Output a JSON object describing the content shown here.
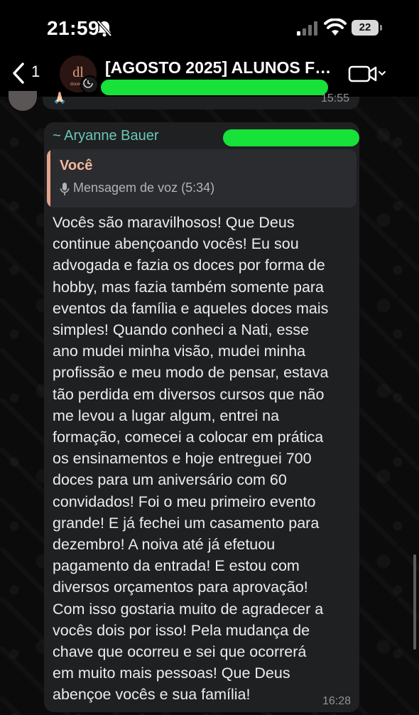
{
  "status_bar": {
    "time": "21:59",
    "battery": "22"
  },
  "header": {
    "back_count": "1",
    "title": "[AGOSTO 2025] ALUNOS FO...",
    "avatar_text": "dl",
    "avatar_subtext": "docevial"
  },
  "previous_message": {
    "emoji": "🙏🏻",
    "time": "15:55"
  },
  "message": {
    "sender": "~ Aryanne Bauer",
    "quote": {
      "author": "Você",
      "text": "Mensagem de voz (5:34)"
    },
    "text": "Vocês são maravilhosos! Que Deus\ncontinue abençoando vocês! Eu sou\nadvogada e fazia os doces por forma de\nhobby, mas fazia também somente para\neventos da família e aqueles doces mais\nsimples! Quando conheci a Nati, esse\nano mudei minha visão, mudei minha\nprofissão e meu modo de pensar, estava\ntão perdida em diversos cursos que não\nme levou a lugar algum, entrei na\nformação, comecei a colocar em prática\nos ensinamentos e hoje entreguei 700\ndoces para um aniversário com 60\nconvidados! Foi o meu primeiro evento\ngrande! E já fechei um casamento para\ndezembro! A noiva até já efetuou\npagamento da entrada! E estou com\ndiversos orçamentos para aprovação!\nCom isso gostaria muito de agradecer a\nvocês dois por isso! Pela mudança de\nchave que ocorreu e sei que ocorrerá\nem muito mais pessoas! Que Deus\nabençoe vocês e sua família!",
    "time": "16:28"
  },
  "colors": {
    "sender_name": "#6cc6b6",
    "quote_accent": "#e4a58b",
    "bubble": "#1f2022",
    "redaction": "#16e23a"
  }
}
